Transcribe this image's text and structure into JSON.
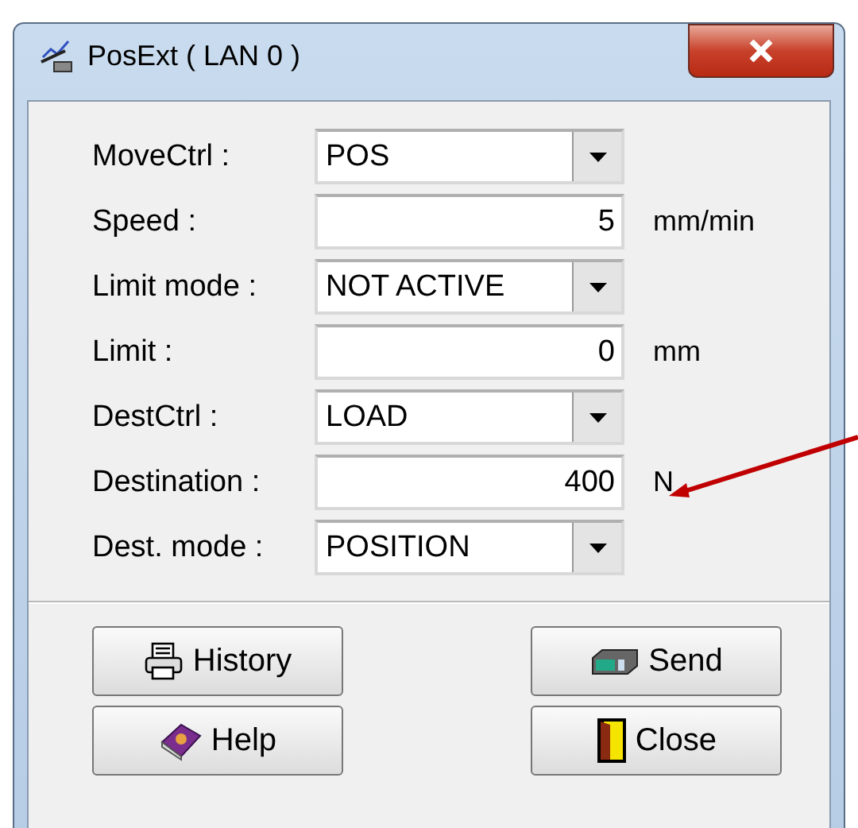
{
  "window": {
    "title": "PosExt ( LAN 0 )"
  },
  "fields": [
    {
      "kind": "combo",
      "label": "MoveCtrl :",
      "value": "POS"
    },
    {
      "kind": "number",
      "label": "Speed :",
      "value": "5",
      "unit": "mm/min"
    },
    {
      "kind": "combo",
      "label": "Limit mode :",
      "value": "NOT ACTIVE"
    },
    {
      "kind": "number",
      "label": "Limit :",
      "value": "0",
      "unit": "mm"
    },
    {
      "kind": "combo",
      "label": "DestCtrl :",
      "value": "LOAD"
    },
    {
      "kind": "number",
      "label": "Destination :",
      "value": "400",
      "unit": "N"
    },
    {
      "kind": "combo",
      "label": "Dest. mode :",
      "value": "POSITION"
    }
  ],
  "buttons": [
    {
      "kind": "history",
      "label": "History"
    },
    {
      "kind": "send",
      "label": "Send"
    },
    {
      "kind": "help",
      "label": "Help"
    },
    {
      "kind": "close",
      "label": "Close"
    }
  ]
}
